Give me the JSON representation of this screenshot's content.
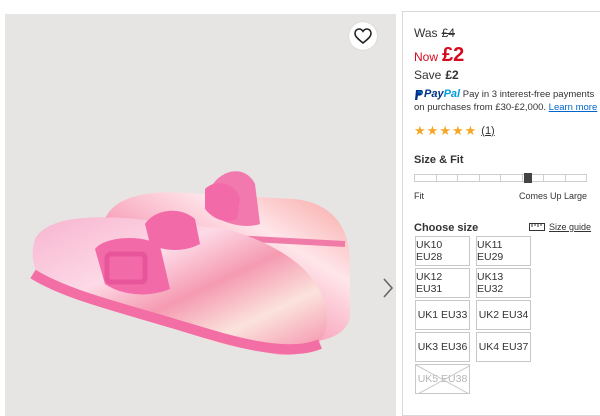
{
  "pricing": {
    "was_label": "Was",
    "was_price": "£4",
    "now_label": "Now",
    "now_price": "£2",
    "save_label": "Save",
    "save_amount": "£2"
  },
  "paypal": {
    "brand_pay": "Pay",
    "brand_pal": "Pal",
    "text": "Pay in 3 interest-free payments on purchases from £30-£2,000.",
    "learn_more": "Learn more"
  },
  "rating": {
    "stars": 5,
    "count": "(1)"
  },
  "size_fit": {
    "title": "Size & Fit",
    "fit_label": "Fit",
    "large_label": "Comes Up Large",
    "segments": 8,
    "marker_fraction": 0.625
  },
  "choose_size": {
    "title": "Choose size",
    "guide_label": "Size guide",
    "sizes": [
      {
        "label": "UK10 EU28",
        "available": true
      },
      {
        "label": "UK11 EU29",
        "available": true
      },
      {
        "label": "UK12 EU31",
        "available": true
      },
      {
        "label": "UK13 EU32",
        "available": true
      },
      {
        "label": "UK1 EU33",
        "available": true
      },
      {
        "label": "UK2 EU34",
        "available": true
      },
      {
        "label": "UK3 EU36",
        "available": true
      },
      {
        "label": "UK4 EU37",
        "available": true
      },
      {
        "label": "UK5 EU38",
        "available": false
      }
    ]
  },
  "colors": {
    "sale_red": "#d50a1d",
    "star": "#f5a623",
    "link": "#0066cc",
    "clog_pink": "#f27fb3"
  },
  "icons": {
    "wishlist": "heart-outline-icon",
    "next": "chevron-right-icon",
    "size_guide": "ruler-icon",
    "paypal": "paypal-logo-icon"
  }
}
